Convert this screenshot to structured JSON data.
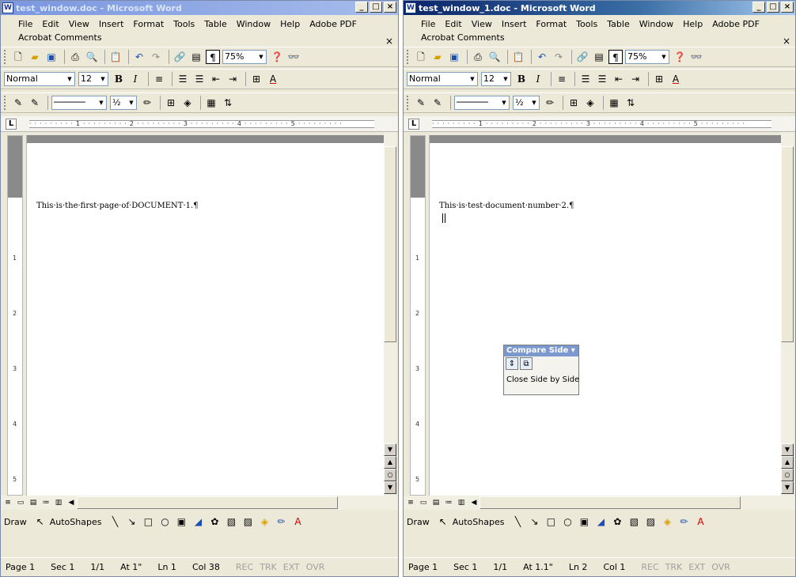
{
  "left": {
    "title": "test_window.doc - Microsoft Word",
    "menu": [
      "File",
      "Edit",
      "View",
      "Insert",
      "Format",
      "Tools",
      "Table",
      "Window",
      "Help",
      "Adobe PDF"
    ],
    "menu2": "Acrobat Comments",
    "style": "Normal",
    "font_size": "12",
    "zoom": "75%",
    "doc_text": "This·is·the·first·page·of·DOCUMENT·1.¶",
    "draw_label": "Draw",
    "autoshapes_label": "AutoShapes",
    "status": {
      "page": "Page 1",
      "sec": "Sec 1",
      "pages": "1/1",
      "at": "At 1\"",
      "ln": "Ln 1",
      "col": "Col 38"
    }
  },
  "right": {
    "title": "test_window_1.doc - Microsoft Word",
    "menu": [
      "File",
      "Edit",
      "View",
      "Insert",
      "Format",
      "Tools",
      "Table",
      "Window",
      "Help",
      "Adobe PDF"
    ],
    "menu2": "Acrobat Comments",
    "style": "Normal",
    "font_size": "12",
    "zoom": "75%",
    "doc_text": "This·is·test·document·number·2.¶",
    "draw_label": "Draw",
    "autoshapes_label": "AutoShapes",
    "status": {
      "page": "Page 1",
      "sec": "Sec 1",
      "pages": "1/1",
      "at": "At 1.1\"",
      "ln": "Ln 2",
      "col": "Col 1"
    }
  },
  "status_flags": [
    "REC",
    "TRK",
    "EXT",
    "OVR"
  ],
  "compare": {
    "title": "Compare Side",
    "close_label": "Close Side by Side"
  },
  "ruler_numbers": [
    "1",
    "2",
    "3",
    "4",
    "5"
  ],
  "vruler_numbers": [
    "1",
    "2",
    "3",
    "4",
    "5"
  ]
}
